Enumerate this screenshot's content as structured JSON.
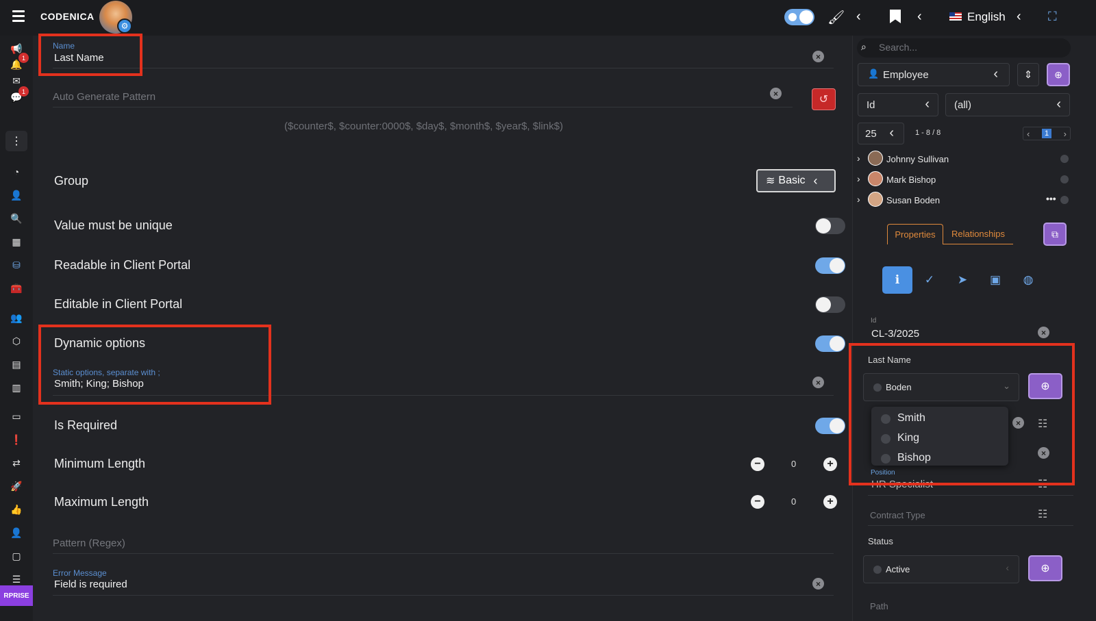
{
  "app": {
    "brand": "CODENICA"
  },
  "topbar": {
    "language": "English"
  },
  "leftrail": {
    "badge_notifications": "1",
    "badge_messages": "1",
    "edition_label": "RPRISE"
  },
  "form": {
    "name_label": "Name",
    "name_value": "Last Name",
    "auto_pattern_placeholder": "Auto Generate Pattern",
    "pattern_hint": "($counter$, $counter:0000$, $day$, $month$, $year$, $link$)",
    "group_label": "Group",
    "group_value": "Basic",
    "unique_label": "Value must be unique",
    "readable_label": "Readable in Client Portal",
    "editable_label": "Editable in Client Portal",
    "dynamic_label": "Dynamic options",
    "static_options_label": "Static options, separate with ;",
    "static_options_value": "Smith; King; Bishop",
    "required_label": "Is Required",
    "min_label": "Minimum Length",
    "min_value": "0",
    "max_label": "Maximum Length",
    "max_value": "0",
    "regex_placeholder": "Pattern (Regex)",
    "error_label": "Error Message",
    "error_value": "Field is required"
  },
  "toggles": {
    "unique": false,
    "readable": true,
    "editable": false,
    "dynamic": true,
    "required": true
  },
  "panel": {
    "search_placeholder": "Search...",
    "entity": "Employee",
    "filter_field": "Id",
    "filter_value": "(all)",
    "page_size": "25",
    "range": "1 - 8 / 8",
    "page": "1",
    "records": [
      {
        "name": "Johnny Sullivan"
      },
      {
        "name": "Mark Bishop"
      },
      {
        "name": "Susan Boden"
      }
    ],
    "tab_properties": "Properties",
    "tab_relationships": "Relationships",
    "id_label": "Id",
    "id_value": "CL-3/2025",
    "last_name_label": "Last Name",
    "last_name_value": "Boden",
    "options": [
      "Smith",
      "King",
      "Bishop"
    ],
    "position_label": "Position",
    "position_value": "HR Specialist",
    "contract_label": "Contract Type",
    "status_label": "Status",
    "status_value": "Active",
    "path_label": "Path"
  }
}
